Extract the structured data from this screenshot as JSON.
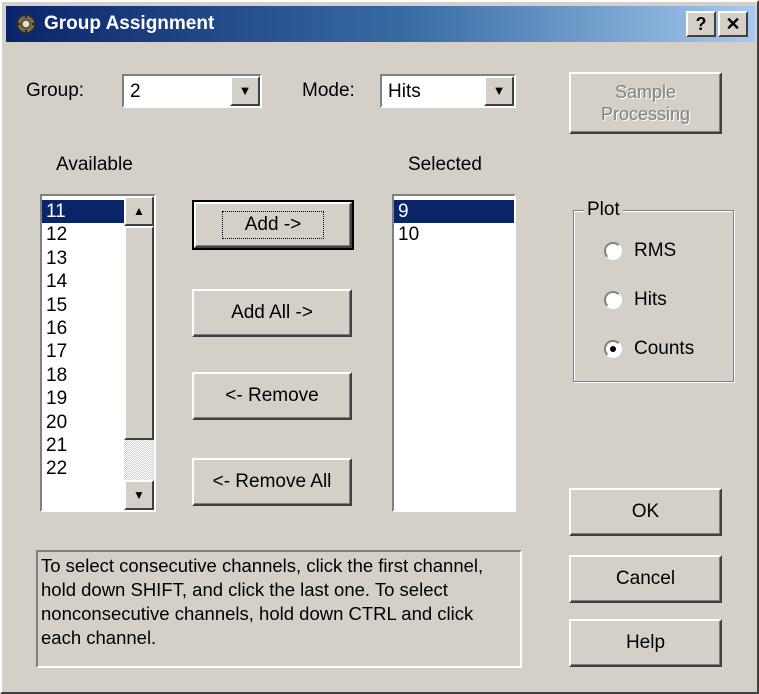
{
  "window": {
    "title": "Group Assignment",
    "help_button": "?",
    "close_button": "✕"
  },
  "group": {
    "label": "Group:",
    "value": "2"
  },
  "mode": {
    "label": "Mode:",
    "value": "Hits"
  },
  "sample_processing": {
    "line1": "Sample",
    "line2": "Processing",
    "enabled": false
  },
  "available": {
    "label": "Available",
    "items": [
      "11",
      "12",
      "13",
      "14",
      "15",
      "16",
      "17",
      "18",
      "19",
      "20",
      "21",
      "22"
    ],
    "selected_index": 0
  },
  "selected": {
    "label": "Selected",
    "items": [
      "9",
      "10"
    ],
    "selected_index": 0
  },
  "buttons": {
    "add": "Add ->",
    "add_all": "Add All ->",
    "remove": "<- Remove",
    "remove_all": "<- Remove All",
    "ok": "OK",
    "cancel": "Cancel",
    "help": "Help"
  },
  "plot": {
    "label": "Plot",
    "options": [
      "RMS",
      "Hits",
      "Counts"
    ],
    "checked": "Counts"
  },
  "instructions": "To select consecutive channels, click the first channel, hold down SHIFT, and click the last one. To select nonconsecutive channels, hold down CTRL and click each channel.",
  "colors": {
    "title_start": "#0a246a",
    "title_end": "#a6caf0",
    "selection": "#0a246a",
    "face": "#d4d0c8"
  }
}
